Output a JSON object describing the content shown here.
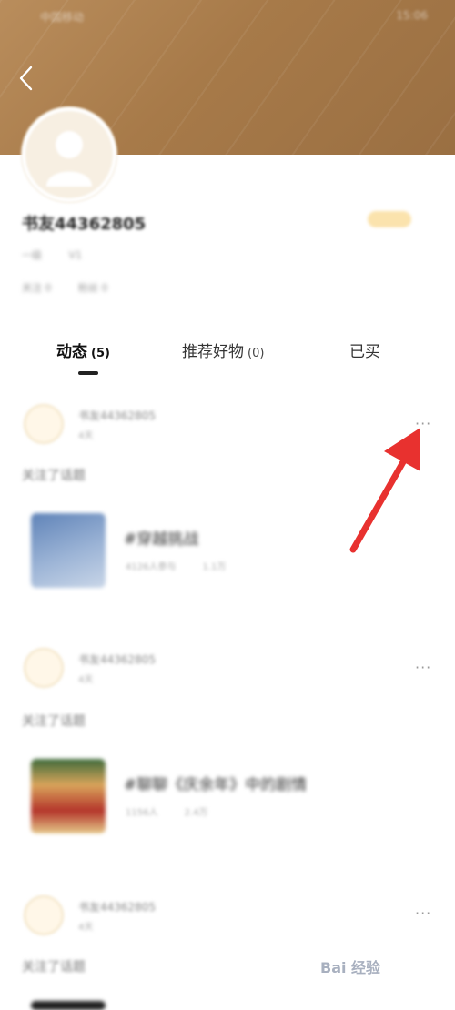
{
  "status_bar": {
    "left": "中国移动",
    "right": "15:06"
  },
  "profile": {
    "username": "书友44362805",
    "meta_1": [
      "一级",
      "V1"
    ],
    "meta_2": [
      "关注 0",
      "粉丝 0"
    ]
  },
  "tabs": [
    {
      "label": "动态",
      "count": "(5)",
      "active": true
    },
    {
      "label": "推荐好物",
      "count": "(0)",
      "active": false
    },
    {
      "label": "已买",
      "count": "",
      "active": false
    }
  ],
  "posts": [
    {
      "name": "书友44362805",
      "time": "4天",
      "action": "关注了话题",
      "topic_title": "#穿越挑战",
      "stats": [
        "4126人参与",
        "1.1万"
      ]
    },
    {
      "name": "书友44362805",
      "time": "4天",
      "action": "关注了话题",
      "topic_title": "#聊聊《庆余年》中的剧情",
      "stats": [
        "1156人",
        "2.4万"
      ]
    },
    {
      "name": "书友44362805",
      "time": "4天",
      "action": "关注了话题"
    }
  ],
  "more_label": "···",
  "watermark": "Bai 经验",
  "colors": {
    "header": "#a77a49",
    "accent": "#e8312f",
    "badge": "#fbe3ad"
  },
  "icons": {
    "back": "chevron-left-icon",
    "arrow": "annotation-arrow",
    "more": "more-dots-icon"
  }
}
